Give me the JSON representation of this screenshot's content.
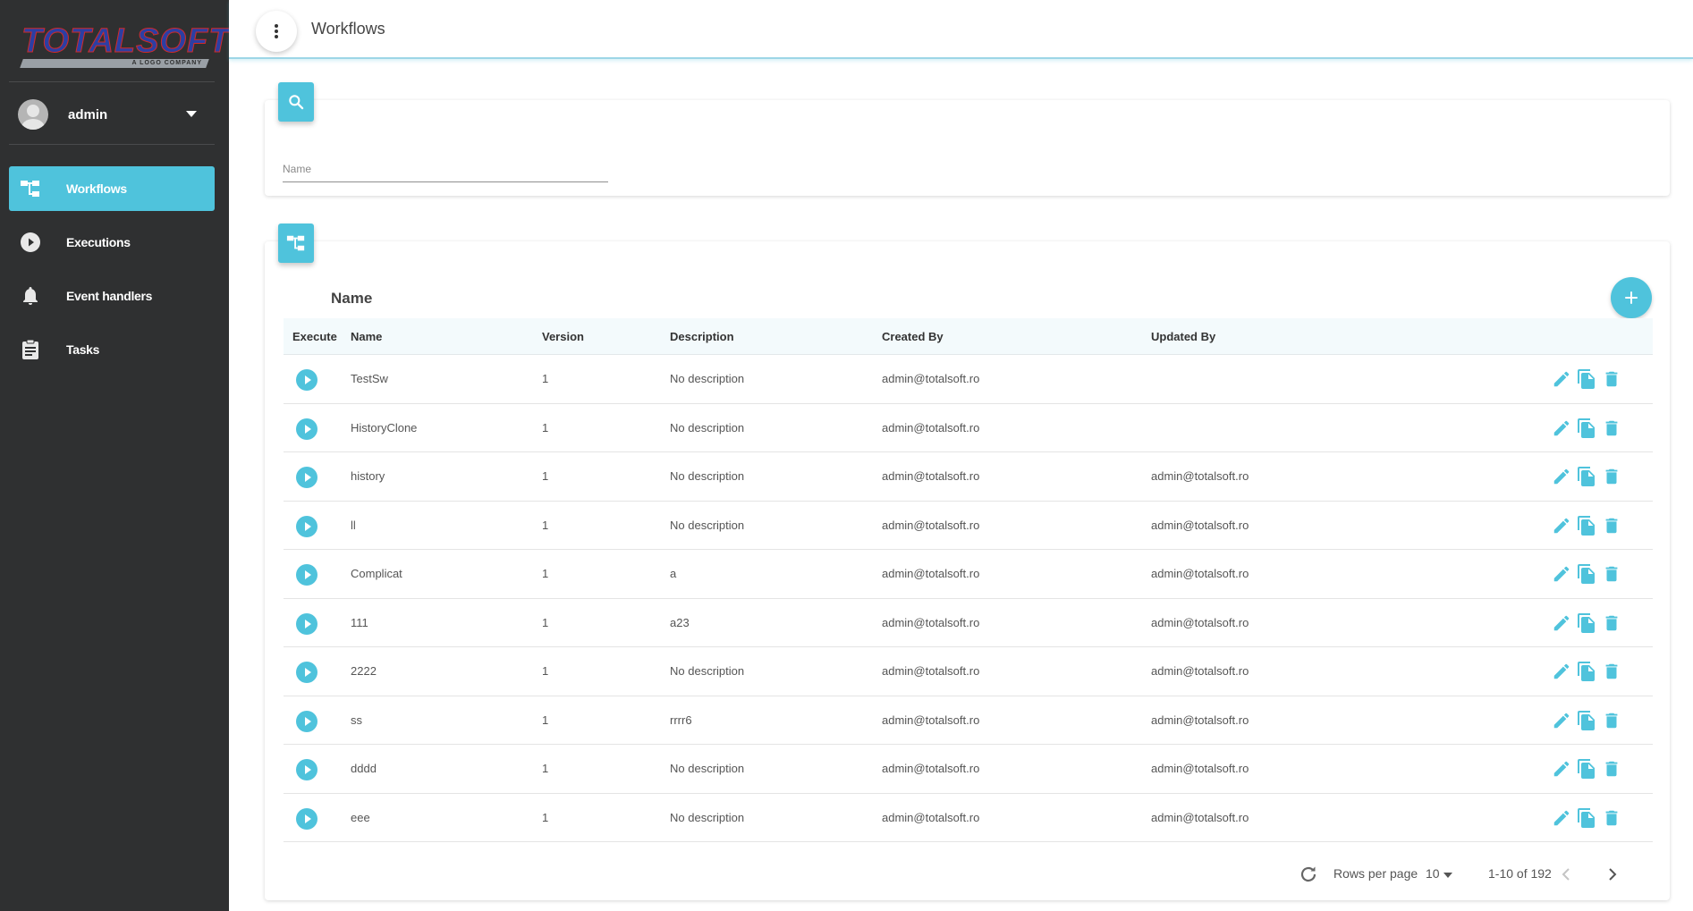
{
  "brand": {
    "name": "TOTALSOFT",
    "tagline": "A LOGO COMPANY"
  },
  "user": {
    "name": "admin"
  },
  "nav": [
    {
      "label": "Workflows",
      "icon": "workflow-icon",
      "active": true
    },
    {
      "label": "Executions",
      "icon": "play-circle-icon",
      "active": false
    },
    {
      "label": "Event handlers",
      "icon": "bell-icon",
      "active": false
    },
    {
      "label": "Tasks",
      "icon": "clipboard-icon",
      "active": false
    }
  ],
  "topbar": {
    "title": "Workflows"
  },
  "filter": {
    "placeholder": "Name",
    "value": ""
  },
  "list": {
    "title": "Name",
    "columns": [
      "Execute",
      "Name",
      "Version",
      "Description",
      "Created By",
      "Updated By"
    ],
    "rows": [
      {
        "name": "TestSw",
        "version": "1",
        "description": "No description",
        "created_by": "admin@totalsoft.ro",
        "updated_by": ""
      },
      {
        "name": "HistoryClone",
        "version": "1",
        "description": "No description",
        "created_by": "admin@totalsoft.ro",
        "updated_by": ""
      },
      {
        "name": "history",
        "version": "1",
        "description": "No description",
        "created_by": "admin@totalsoft.ro",
        "updated_by": "admin@totalsoft.ro"
      },
      {
        "name": "ll",
        "version": "1",
        "description": "No description",
        "created_by": "admin@totalsoft.ro",
        "updated_by": "admin@totalsoft.ro"
      },
      {
        "name": "Complicat",
        "version": "1",
        "description": "a",
        "created_by": "admin@totalsoft.ro",
        "updated_by": "admin@totalsoft.ro"
      },
      {
        "name": "111",
        "version": "1",
        "description": "a23",
        "created_by": "admin@totalsoft.ro",
        "updated_by": "admin@totalsoft.ro"
      },
      {
        "name": "2222",
        "version": "1",
        "description": "No description",
        "created_by": "admin@totalsoft.ro",
        "updated_by": "admin@totalsoft.ro"
      },
      {
        "name": "ss",
        "version": "1",
        "description": "rrrr6",
        "created_by": "admin@totalsoft.ro",
        "updated_by": "admin@totalsoft.ro"
      },
      {
        "name": "dddd",
        "version": "1",
        "description": "No description",
        "created_by": "admin@totalsoft.ro",
        "updated_by": "admin@totalsoft.ro"
      },
      {
        "name": "eee",
        "version": "1",
        "description": "No description",
        "created_by": "admin@totalsoft.ro",
        "updated_by": "admin@totalsoft.ro"
      }
    ]
  },
  "pagination": {
    "rows_per_page_label": "Rows per page",
    "rows_per_page": "10",
    "range": "1-10 of 192"
  },
  "colors": {
    "accent": "#4fc3dc",
    "sidebar": "#2f3031"
  }
}
